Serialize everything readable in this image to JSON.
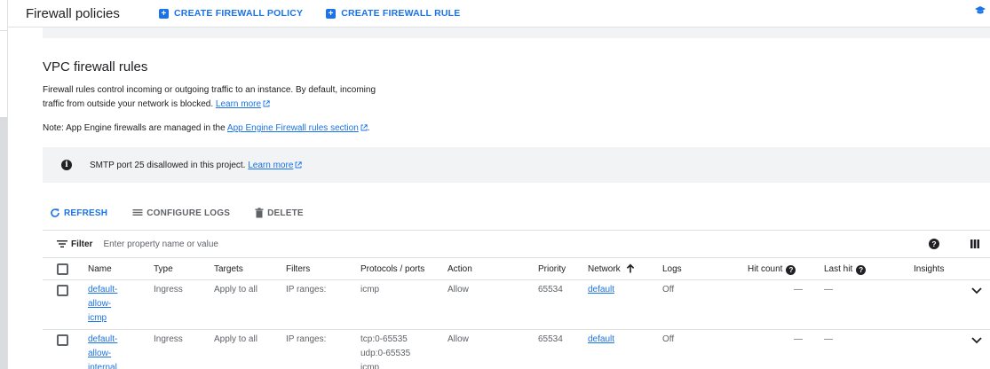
{
  "header": {
    "title": "Firewall policies",
    "create_policy": "CREATE FIREWALL POLICY",
    "create_rule": "CREATE FIREWALL RULE"
  },
  "section": {
    "title": "VPC firewall rules",
    "desc_line1": "Firewall rules control incoming or outgoing traffic to an instance. By default, incoming",
    "desc_line2": "traffic from outside your network is blocked.",
    "learn_more": "Learn more",
    "note_prefix": "Note: App Engine firewalls are managed in the",
    "note_link": "App Engine Firewall rules section",
    "note_suffix": "."
  },
  "banner": {
    "text": "SMTP port 25 disallowed in this project.",
    "link": "Learn more"
  },
  "actions": {
    "refresh": "REFRESH",
    "configure_logs": "CONFIGURE LOGS",
    "delete": "DELETE"
  },
  "filter": {
    "label": "Filter",
    "placeholder": "Enter property name or value"
  },
  "columns": {
    "name": "Name",
    "type": "Type",
    "targets": "Targets",
    "filters": "Filters",
    "protocols": "Protocols / ports",
    "action": "Action",
    "priority": "Priority",
    "network": "Network",
    "logs": "Logs",
    "hit_count": "Hit count",
    "last_hit": "Last hit",
    "insights": "Insights"
  },
  "rows": [
    {
      "name_lines": [
        "default-",
        "allow-",
        "icmp"
      ],
      "type": "Ingress",
      "targets": "Apply to all",
      "filters": "IP ranges:",
      "protocols": [
        "icmp"
      ],
      "action": "Allow",
      "priority": "65534",
      "network": "default",
      "logs": "Off",
      "hit_count": "—",
      "last_hit": "—"
    },
    {
      "name_lines": [
        "default-",
        "allow-",
        "internal"
      ],
      "type": "Ingress",
      "targets": "Apply to all",
      "filters": "IP ranges:",
      "protocols": [
        "tcp:0-65535",
        "udp:0-65535",
        "icmp"
      ],
      "action": "Allow",
      "priority": "65534",
      "network": "default",
      "logs": "Off",
      "hit_count": "—",
      "last_hit": "—"
    }
  ],
  "colors": {
    "accent": "#1a73e8",
    "text": "#202124",
    "muted": "#5f6368",
    "banner_bg": "#f1f3f4"
  }
}
